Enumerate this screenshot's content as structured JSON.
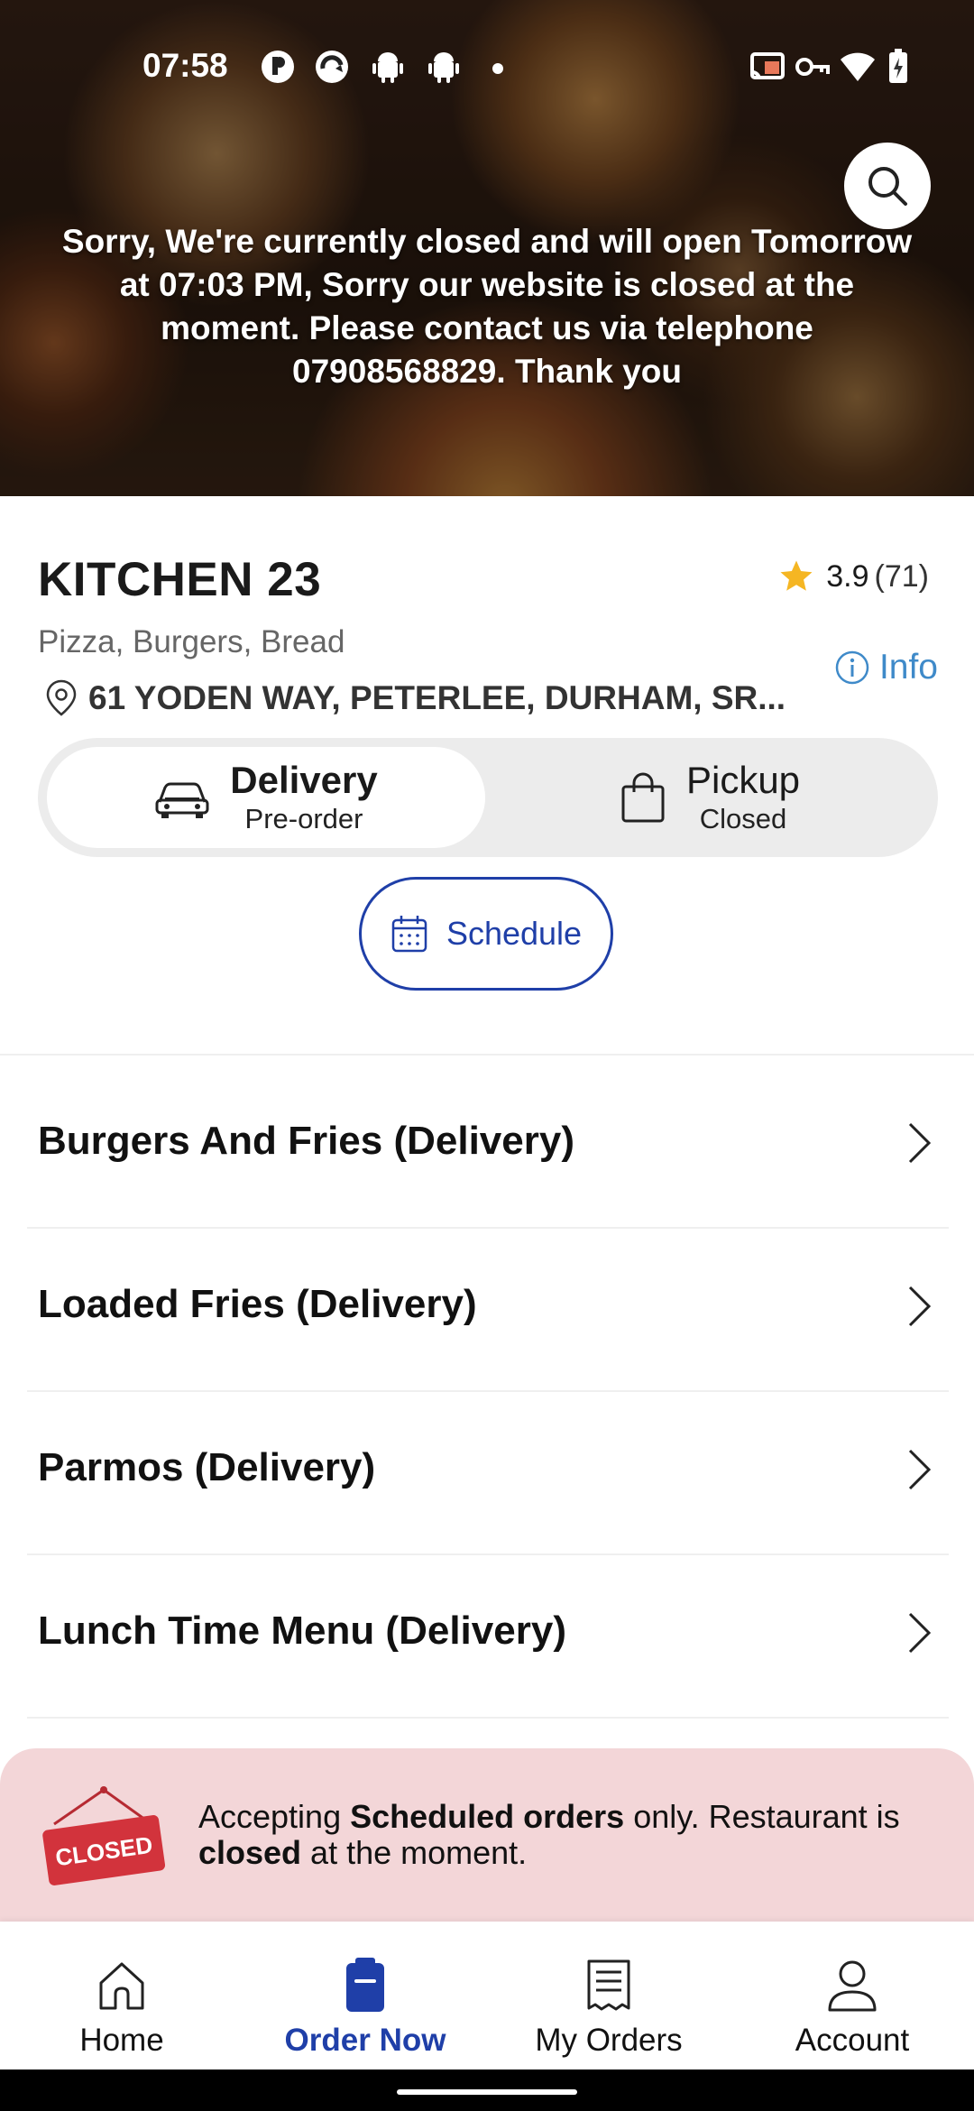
{
  "status_bar": {
    "time": "07:58",
    "left_icons": [
      "app-icon-1",
      "app-icon-2",
      "android-icon",
      "android-icon",
      "dot-icon"
    ],
    "right_icons": [
      "cast-icon",
      "vpn-key-icon",
      "wifi-icon",
      "battery-charging-icon"
    ]
  },
  "hero": {
    "closed_message": "Sorry, We're currently closed and will open Tomorrow at 07:03 PM, Sorry our website is closed at the moment. Please contact us via telephone 07908568829. Thank you"
  },
  "restaurant": {
    "name": "KITCHEN 23",
    "rating": "3.9",
    "rating_count": "(71)",
    "cuisines": "Pizza, Burgers, Bread",
    "info_label": "Info",
    "address": "61 YODEN WAY, PETERLEE, DURHAM, SR..."
  },
  "order_mode": {
    "delivery": {
      "label": "Delivery",
      "status": "Pre-order",
      "selected": true
    },
    "pickup": {
      "label": "Pickup",
      "status": "Closed",
      "selected": false
    }
  },
  "schedule": {
    "label": "Schedule"
  },
  "menu_categories": [
    {
      "label": "Burgers And Fries (Delivery)"
    },
    {
      "label": "Loaded Fries (Delivery)"
    },
    {
      "label": "Parmos (Delivery)"
    },
    {
      "label": "Lunch Time Menu (Delivery)"
    }
  ],
  "closed_banner": {
    "sign_text": "CLOSED",
    "text_1": "Accepting ",
    "bold_1": "Scheduled orders",
    "text_2": " only. Restaurant is ",
    "bold_2": "closed",
    "text_3": " at the moment."
  },
  "bottom_nav": {
    "items": [
      {
        "label": "Home",
        "icon": "home-icon"
      },
      {
        "label": "Order Now",
        "icon": "order-now-icon",
        "active": true
      },
      {
        "label": "My Orders",
        "icon": "receipt-icon"
      },
      {
        "label": "Account",
        "icon": "person-icon"
      }
    ]
  },
  "colors": {
    "accent_blue": "#1f3fa8",
    "info_blue": "#3f8ac9",
    "star_yellow": "#f5b623",
    "banner_pink": "#f3d6d8",
    "closed_sign_red": "#d2333c"
  }
}
